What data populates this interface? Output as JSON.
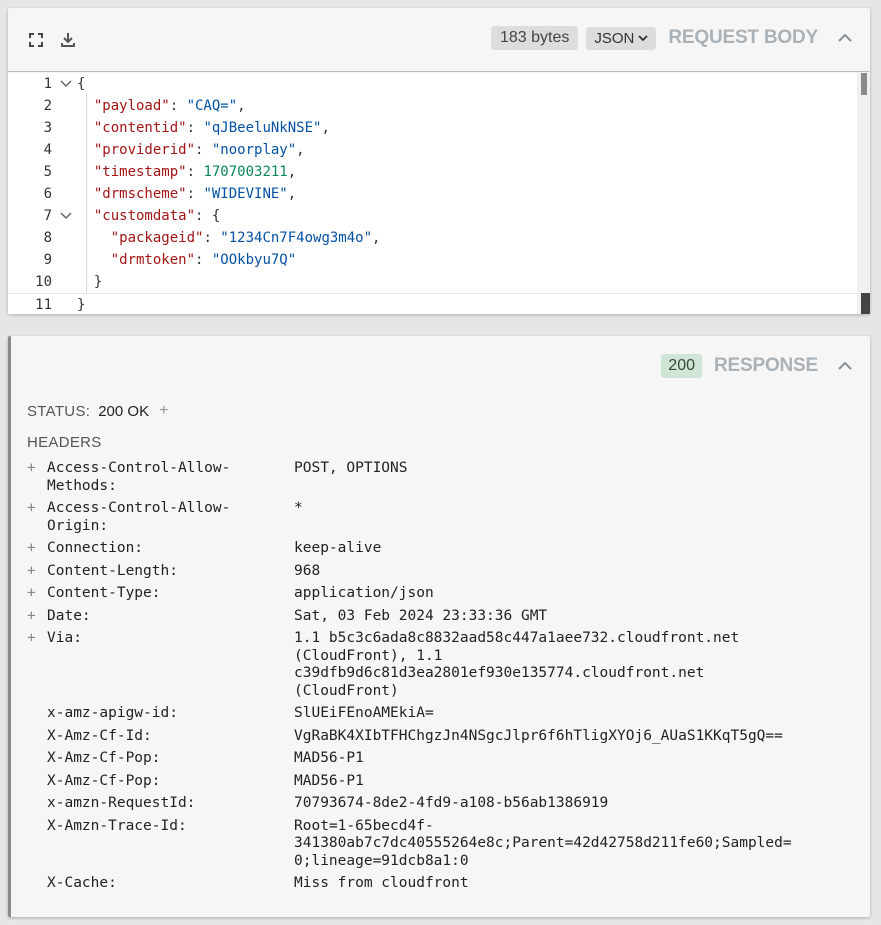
{
  "request": {
    "bytes_badge": "183 bytes",
    "format_select": "JSON",
    "title": "REQUEST BODY",
    "lines": [
      {
        "n": "1",
        "fold": true,
        "tokens": [
          {
            "c": "p",
            "t": "{"
          }
        ]
      },
      {
        "n": "2",
        "fold": false,
        "tokens": [
          {
            "c": "p",
            "t": "  "
          },
          {
            "c": "k",
            "t": "\"payload\""
          },
          {
            "c": "p",
            "t": ": "
          },
          {
            "c": "s",
            "t": "\"CAQ=\""
          },
          {
            "c": "p",
            "t": ","
          }
        ]
      },
      {
        "n": "3",
        "fold": false,
        "tokens": [
          {
            "c": "p",
            "t": "  "
          },
          {
            "c": "k",
            "t": "\"contentid\""
          },
          {
            "c": "p",
            "t": ": "
          },
          {
            "c": "s",
            "t": "\"qJBeeluNkNSE\""
          },
          {
            "c": "p",
            "t": ","
          }
        ]
      },
      {
        "n": "4",
        "fold": false,
        "tokens": [
          {
            "c": "p",
            "t": "  "
          },
          {
            "c": "k",
            "t": "\"providerid\""
          },
          {
            "c": "p",
            "t": ": "
          },
          {
            "c": "s",
            "t": "\"noorplay\""
          },
          {
            "c": "p",
            "t": ","
          }
        ]
      },
      {
        "n": "5",
        "fold": false,
        "tokens": [
          {
            "c": "p",
            "t": "  "
          },
          {
            "c": "k",
            "t": "\"timestamp\""
          },
          {
            "c": "p",
            "t": ": "
          },
          {
            "c": "n",
            "t": "1707003211"
          },
          {
            "c": "p",
            "t": ","
          }
        ]
      },
      {
        "n": "6",
        "fold": false,
        "tokens": [
          {
            "c": "p",
            "t": "  "
          },
          {
            "c": "k",
            "t": "\"drmscheme\""
          },
          {
            "c": "p",
            "t": ": "
          },
          {
            "c": "s",
            "t": "\"WIDEVINE\""
          },
          {
            "c": "p",
            "t": ","
          }
        ]
      },
      {
        "n": "7",
        "fold": true,
        "tokens": [
          {
            "c": "p",
            "t": "  "
          },
          {
            "c": "k",
            "t": "\"customdata\""
          },
          {
            "c": "p",
            "t": ": {"
          }
        ]
      },
      {
        "n": "8",
        "fold": false,
        "tokens": [
          {
            "c": "p",
            "t": "    "
          },
          {
            "c": "k",
            "t": "\"packageid\""
          },
          {
            "c": "p",
            "t": ": "
          },
          {
            "c": "s",
            "t": "\"1234Cn7F4owg3m4o\""
          },
          {
            "c": "p",
            "t": ","
          }
        ]
      },
      {
        "n": "9",
        "fold": false,
        "tokens": [
          {
            "c": "p",
            "t": "    "
          },
          {
            "c": "k",
            "t": "\"drmtoken\""
          },
          {
            "c": "p",
            "t": ": "
          },
          {
            "c": "s",
            "t": "\"OOkbyu7Q\""
          }
        ]
      },
      {
        "n": "10",
        "fold": false,
        "tokens": [
          {
            "c": "p",
            "t": "  }"
          }
        ]
      },
      {
        "n": "11",
        "fold": false,
        "tokens": [
          {
            "c": "p",
            "t": "}"
          }
        ]
      }
    ]
  },
  "response": {
    "status_badge": "200",
    "title": "RESPONSE",
    "status_label": "STATUS:",
    "status_value": "200 OK",
    "status_plus": "+",
    "headers_title": "HEADERS",
    "headers": [
      {
        "plus": "+",
        "name": "Access-Control-Allow-\nMethods:",
        "value": "POST, OPTIONS"
      },
      {
        "plus": "+",
        "name": "Access-Control-Allow-\nOrigin:",
        "value": "*"
      },
      {
        "plus": "+",
        "name": "Connection:",
        "value": "keep-alive"
      },
      {
        "plus": "+",
        "name": "Content-Length:",
        "value": "968"
      },
      {
        "plus": "+",
        "name": "Content-Type:",
        "value": "application/json"
      },
      {
        "plus": "+",
        "name": "Date:",
        "value": "Sat, 03 Feb 2024 23:33:36 GMT"
      },
      {
        "plus": "+",
        "name": "Via:",
        "value": "1.1 b5c3c6ada8c8832aad58c447a1aee732.cloudfront.net\n(CloudFront), 1.1\nc39dfb9d6c81d3ea2801ef930e135774.cloudfront.net\n(CloudFront)"
      },
      {
        "plus": "",
        "name": "x-amz-apigw-id:",
        "value": "SlUEiFEnoAMEkiA="
      },
      {
        "plus": "",
        "name": "X-Amz-Cf-Id:",
        "value": "VgRaBK4XIbTFHChgzJn4NSgcJlpr6f6hTligXYOj6_AUaS1KKqT5gQ=="
      },
      {
        "plus": "",
        "name": "X-Amz-Cf-Pop:",
        "value": "MAD56-P1"
      },
      {
        "plus": "",
        "name": "X-Amz-Cf-Pop:",
        "value": "MAD56-P1"
      },
      {
        "plus": "",
        "name": "x-amzn-RequestId:",
        "value": "70793674-8de2-4fd9-a108-b56ab1386919"
      },
      {
        "plus": "",
        "name": "X-Amzn-Trace-Id:",
        "value": "Root=1-65becd4f-\n341380ab7c7dc40555264e8c;Parent=42d42758d211fe60;Sampled=\n0;lineage=91dcb8a1:0"
      },
      {
        "plus": "",
        "name": "X-Cache:",
        "value": "Miss from cloudfront"
      }
    ]
  }
}
